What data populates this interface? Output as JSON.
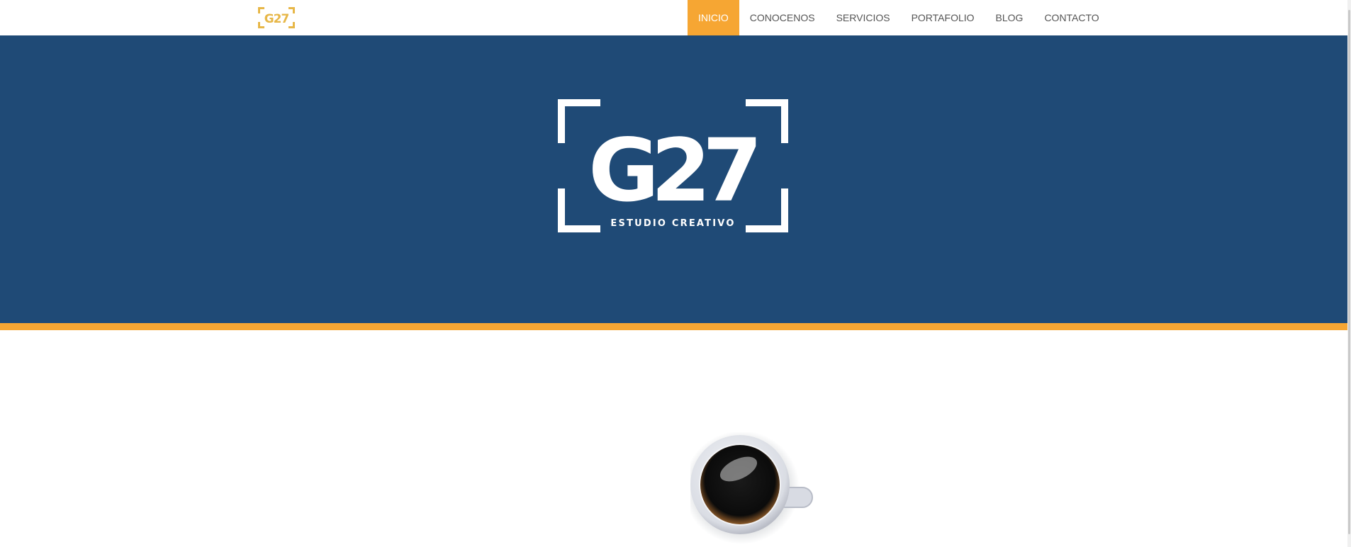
{
  "colors": {
    "brand_navy": "#1f4a76",
    "accent_orange": "#f6a633",
    "logo_gold": "#e7b748",
    "nav_text": "#555555"
  },
  "header": {
    "logo_icon": "g27-logo-small",
    "menu": [
      {
        "label": "INICIO",
        "active": true
      },
      {
        "label": "CONOCENOS",
        "active": false
      },
      {
        "label": "SERVICIOS",
        "active": false
      },
      {
        "label": "PORTAFOLIO",
        "active": false
      },
      {
        "label": "BLOG",
        "active": false
      },
      {
        "label": "CONTACTO",
        "active": false
      }
    ]
  },
  "hero": {
    "logo_text": "G27",
    "tagline": "ESTUDIO CREATIVO"
  },
  "content": {
    "image": "coffee-cup-top-view"
  }
}
